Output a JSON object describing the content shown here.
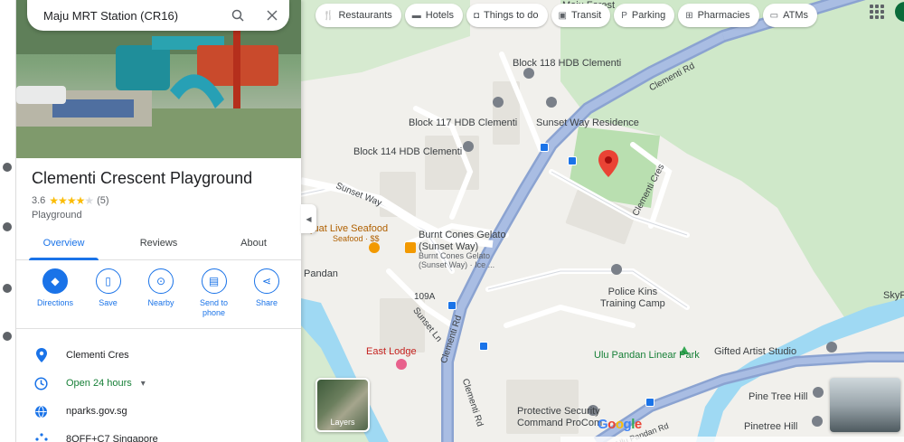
{
  "search": {
    "value": "Maju MRT Station (CR16)"
  },
  "place": {
    "title": "Clementi Crescent Playground",
    "rating": "3.6",
    "stars_full": 3,
    "stars_half": 1,
    "stars_empty": 1,
    "review_count": "(5)",
    "category": "Playground"
  },
  "tabs": [
    {
      "label": "Overview",
      "active": true
    },
    {
      "label": "Reviews",
      "active": false
    },
    {
      "label": "About",
      "active": false
    }
  ],
  "actions": [
    {
      "label": "Directions"
    },
    {
      "label": "Save"
    },
    {
      "label": "Nearby"
    },
    {
      "label": "Send to phone"
    },
    {
      "label": "Share"
    }
  ],
  "info": {
    "address": "Clementi Cres",
    "hours": "Open 24 hours",
    "website": "nparks.gov.sg",
    "pluscode": "8QFF+C7 Singapore"
  },
  "chips": [
    {
      "label": "Restaurants",
      "icon": "restaurant-icon"
    },
    {
      "label": "Hotels",
      "icon": "hotel-icon"
    },
    {
      "label": "Things to do",
      "icon": "camera-icon"
    },
    {
      "label": "Transit",
      "icon": "train-icon"
    },
    {
      "label": "Parking",
      "icon": "parking-icon"
    },
    {
      "label": "Pharmacies",
      "icon": "pharmacy-icon"
    },
    {
      "label": "ATMs",
      "icon": "atm-icon"
    }
  ],
  "map": {
    "labels": {
      "block118": "Block 118 HDB Clementi",
      "block117": "Block 117 HDB Clementi",
      "sunsetResidence": "Sunset Way Residence",
      "block114": "Block 114 HDB Clementi",
      "seafood": "Quat Live Seafood",
      "seafoodPrice": "Seafood · $$",
      "burnt": "Burnt Cones Gelato\n(Sunset Way)",
      "burntSub": "Burnt Cones Gelato\n(Sunset Way) · Ice ...",
      "pandan": "Pandan",
      "policeKins": "Police Kins\nTraining Camp",
      "eastLodge": "East Lodge",
      "uluPandan": "Ulu Pandan Linear Park",
      "gifted": "Gifted Artist Studio",
      "pineTree": "Pine Tree Hill",
      "pinetreeHill": "Pinetree Hill",
      "protective": "Protective Security\nCommand ProCom",
      "skyp": "SkyP",
      "majuForest": "Maju Forest"
    },
    "roads": {
      "clementiRd": "Clementi Rd",
      "clementiRd2": "Clementi Rd",
      "clementiRd3": "Clementi Rd",
      "clementiCres": "Clementi Cres",
      "sunsetWay": "Sunset Way",
      "sunsetLn": "Sunset Ln",
      "r109a": "109A",
      "uluPandanRd": "Ulu Pandan Rd"
    },
    "layers_label": "Layers",
    "logo": "Google"
  },
  "colors": {
    "accent": "#1a73e8",
    "open": "#188038",
    "pin": "#ea4335",
    "road": "#8ba3d1",
    "water": "#9fd9f3",
    "park": "#c6e9c0"
  }
}
